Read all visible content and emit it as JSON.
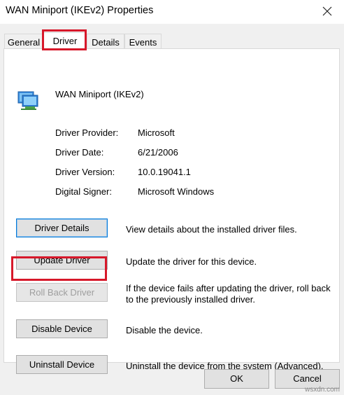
{
  "window": {
    "title": "WAN Miniport (IKEv2) Properties",
    "close_icon": "close-icon"
  },
  "tabs": [
    {
      "label": "General",
      "active": false
    },
    {
      "label": "Driver",
      "active": true
    },
    {
      "label": "Details",
      "active": false
    },
    {
      "label": "Events",
      "active": false
    }
  ],
  "device": {
    "icon": "network-adapter-icon",
    "name": "WAN Miniport (IKEv2)"
  },
  "properties": [
    {
      "label": "Driver Provider:",
      "value": "Microsoft"
    },
    {
      "label": "Driver Date:",
      "value": "6/21/2006"
    },
    {
      "label": "Driver Version:",
      "value": "10.0.19041.1"
    },
    {
      "label": "Digital Signer:",
      "value": "Microsoft Windows"
    }
  ],
  "actions": [
    {
      "button": "Driver Details",
      "description": "View details about the installed driver files.",
      "enabled": true
    },
    {
      "button": "Update Driver",
      "description": "Update the driver for this device.",
      "enabled": true
    },
    {
      "button": "Roll Back Driver",
      "description": "If the device fails after updating the driver, roll back to the previously installed driver.",
      "enabled": false
    },
    {
      "button": "Disable Device",
      "description": "Disable the device.",
      "enabled": true
    },
    {
      "button": "Uninstall Device",
      "description": "Uninstall the device from the system (Advanced).",
      "enabled": true
    }
  ],
  "footer": {
    "ok_label": "OK",
    "cancel_label": "Cancel"
  },
  "watermark": "wsxdn.com",
  "colors": {
    "highlight": "#d7182a",
    "focus_border": "#0078d7",
    "dialog_background": "#f0f0f0"
  }
}
